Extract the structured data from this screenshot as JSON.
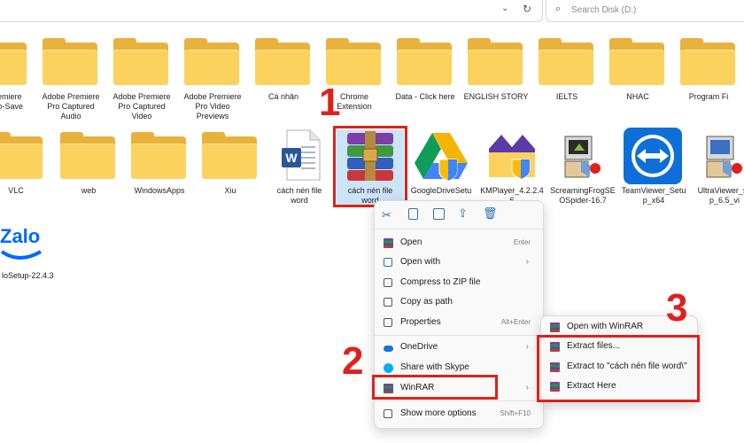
{
  "search": {
    "placeholder": "Search Disk (D:)"
  },
  "folders_row1": [
    {
      "label": "be Premiere\nro Auto-Save"
    },
    {
      "label": "Adobe Premiere\nPro Captured\nAudio"
    },
    {
      "label": "Adobe Premiere\nPro Captured\nVideo"
    },
    {
      "label": "Adobe Premiere\nPro Video\nPreviews"
    },
    {
      "label": "Cá nhân"
    },
    {
      "label": "Chrome\nExtension"
    },
    {
      "label": "Data - Click here"
    },
    {
      "label": "ENGLISH STORY"
    },
    {
      "label": "IELTS"
    },
    {
      "label": "NHAC"
    },
    {
      "label": "Program Fi"
    }
  ],
  "folders_row2": [
    {
      "label": "VLC"
    },
    {
      "label": "web"
    },
    {
      "label": "WindowsApps"
    },
    {
      "label": "Xiu"
    }
  ],
  "files_row2": [
    {
      "label": "cách nén file\nword",
      "icon": "word-doc-icon"
    },
    {
      "label": "cách nén file\nword",
      "icon": "winrar-archive-icon"
    },
    {
      "label": "GoogleDriveSetu",
      "icon": "google-drive-icon"
    },
    {
      "label": "KMPlayer_4.2.2.4\n6",
      "icon": "kmplayer-icon"
    },
    {
      "label": "ScreamingFrogSE\nOSpider-16.7",
      "icon": "installer-icon"
    },
    {
      "label": "TeamViewer_Setu\np_x64",
      "icon": "teamviewer-icon"
    },
    {
      "label": "UltraViewer_se\np_6.5_vi",
      "icon": "installer-icon"
    }
  ],
  "zalo": {
    "logo": "Zalo",
    "label": "loSetup-22.4.3"
  },
  "context_menu": {
    "items": [
      {
        "label": "Open",
        "shortcut": "Enter"
      },
      {
        "label": "Open with",
        "arrow": "›"
      },
      {
        "label": "Compress to ZIP file"
      },
      {
        "label": "Copy as path"
      },
      {
        "label": "Properties",
        "shortcut": "Alt+Enter"
      },
      {
        "label": "OneDrive",
        "arrow": "›"
      },
      {
        "label": "Share with Skype"
      },
      {
        "label": "WinRAR",
        "arrow": "›"
      },
      {
        "label": "Show more options",
        "shortcut": "Shift+F10"
      }
    ]
  },
  "winrar_submenu": {
    "items": [
      {
        "label": "Open with WinRAR"
      },
      {
        "label": "Extract files..."
      },
      {
        "label": "Extract to \"cách nén file word\\\""
      },
      {
        "label": "Extract Here"
      }
    ]
  },
  "steps": [
    "1",
    "2",
    "3"
  ],
  "colors": {
    "highlight": "#e0201b",
    "folder": "#fcd25e",
    "teamviewer": "#0e6fd8"
  }
}
